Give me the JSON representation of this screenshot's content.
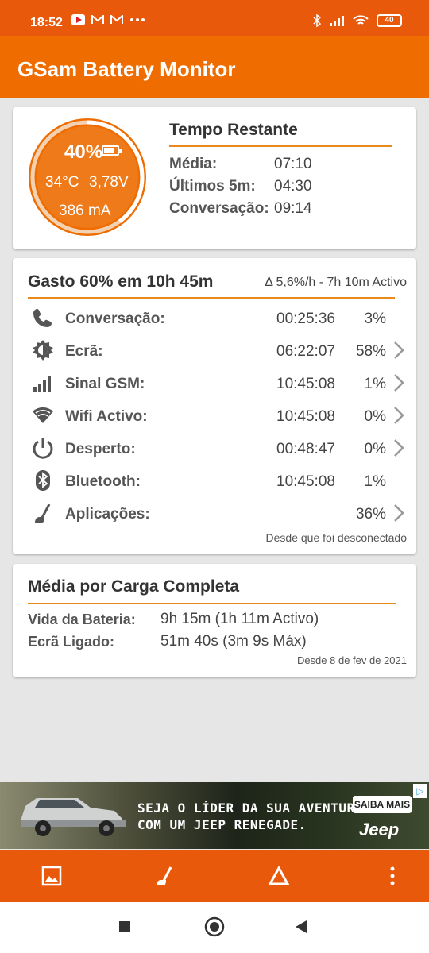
{
  "status_bar": {
    "time": "18:52",
    "left_icons": [
      "youtube-icon",
      "gmail-icon",
      "gmail-icon",
      "more-dots-icon"
    ],
    "right_icons": [
      "bluetooth-icon",
      "signal-icon",
      "wifi-icon"
    ],
    "battery_level": "40"
  },
  "app_bar": {
    "title": "GSam Battery Monitor"
  },
  "battery_gauge": {
    "percent": "40%",
    "percent_value": 0.4,
    "temperature": "34°C",
    "voltage": "3,78V",
    "current": "386 mA"
  },
  "time_remaining": {
    "title": "Tempo Restante",
    "rows": [
      {
        "label": "Média:",
        "value": "07:10"
      },
      {
        "label": "Últimos 5m:",
        "value": "04:30"
      },
      {
        "label": "Conversação:",
        "value": "09:14"
      }
    ]
  },
  "usage": {
    "title": "Gasto 60% em 10h 45m",
    "subtitle": "Δ 5,6%/h - 7h 10m Activo",
    "rows": [
      {
        "icon": "phone-icon",
        "label": "Conversação:",
        "time": "00:25:36",
        "percent": "3%",
        "chevron": false
      },
      {
        "icon": "brightness-icon",
        "label": "Ecrã:",
        "time": "06:22:07",
        "percent": "58%",
        "chevron": true
      },
      {
        "icon": "cell-signal-icon",
        "label": "Sinal GSM:",
        "time": "10:45:08",
        "percent": "1%",
        "chevron": true
      },
      {
        "icon": "wifi-icon",
        "label": "Wifi Activo:",
        "time": "10:45:08",
        "percent": "0%",
        "chevron": true
      },
      {
        "icon": "power-icon",
        "label": "Desperto:",
        "time": "00:48:47",
        "percent": "0%",
        "chevron": true
      },
      {
        "icon": "bluetooth-icon",
        "label": "Bluetooth:",
        "time": "10:45:08",
        "percent": "1%",
        "chevron": false
      },
      {
        "icon": "apps-broom-icon",
        "label": "Aplicações:",
        "time": "",
        "percent": "36%",
        "chevron": true
      }
    ],
    "footer": "Desde que foi desconectado"
  },
  "full_charge": {
    "title": "Média por Carga Completa",
    "rows": [
      {
        "label": "Vida da Bateria:",
        "value": "9h 15m (1h 11m Activo)"
      },
      {
        "label": "Ecrã Ligado:",
        "value": "51m 40s (3m 9s Máx)"
      }
    ],
    "footer": "Desde 8 de fev de 2021"
  },
  "ad": {
    "line1": "SEJA O LÍDER DA SUA AVENTURA",
    "line2": "COM UM JEEP RENEGADE.",
    "button": "SAIBA MAIS",
    "brand": "Jeep",
    "adchoices_icon": "adchoices-icon"
  },
  "bottom_bar": {
    "icons": [
      "image-icon",
      "apps-broom-icon",
      "delta-icon",
      "overflow-menu-icon"
    ]
  },
  "nav_bar": {
    "icons": [
      "recents-icon",
      "home-icon",
      "back-icon"
    ]
  },
  "colors": {
    "app_bar": "#ef6c00",
    "status_bar": "#e8590c",
    "accent": "#e8891c",
    "background": "#e6e6e6"
  }
}
